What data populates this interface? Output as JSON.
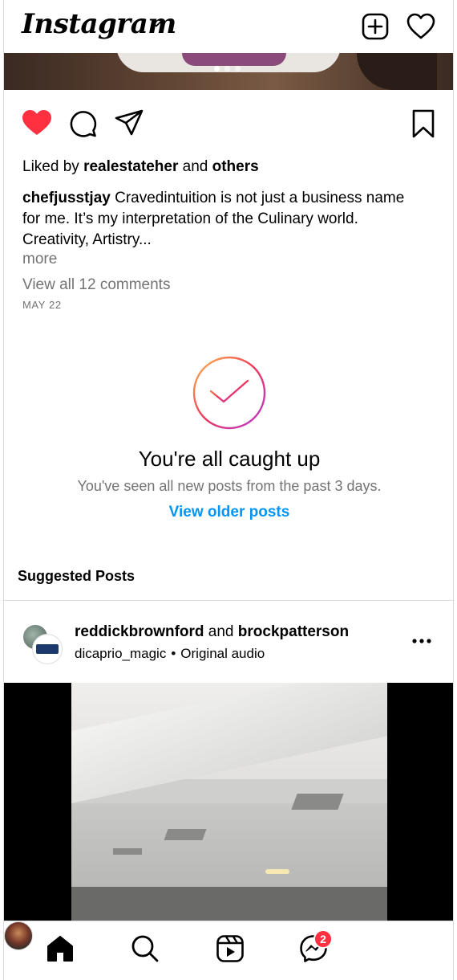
{
  "app": {
    "logo_text": "Instagram"
  },
  "prev_post": {
    "carousel_dots": 3,
    "active_dot": 1,
    "liked_by_prefix": "Liked by",
    "liked_by_user": "realestateher",
    "liked_by_joiner": "and",
    "liked_by_others": "others",
    "caption_user": "chefjusstjay",
    "caption_text": "Cravedintuition is not just a business name for me. It’s my interpretation of the Culinary world. Creativity, Artistry...",
    "more_label": "more",
    "view_comments_label": "View all 12 comments",
    "date": "MAY 22",
    "liked": true
  },
  "caught_up": {
    "title": "You're all caught up",
    "subtitle": "You've seen all new posts from the past 3 days.",
    "link_label": "View older posts"
  },
  "suggested": {
    "heading": "Suggested Posts",
    "post": {
      "user1": "reddickbrownford",
      "joiner": "and",
      "user2": "brockpatterson",
      "audio_user": "dicaprio_magic",
      "separator": "•",
      "audio_label": "Original audio"
    }
  },
  "bottom_nav": {
    "items": [
      {
        "icon": "home-icon",
        "active": true
      },
      {
        "icon": "search-icon"
      },
      {
        "icon": "reels-icon"
      },
      {
        "icon": "messenger-icon",
        "badge": "2"
      },
      {
        "icon": "profile-avatar"
      }
    ]
  },
  "colors": {
    "like_red": "#ff3040",
    "link_blue": "#0095f6",
    "secondary_text": "#737373",
    "border": "#dbdbdb",
    "badge_red": "#ff3040"
  }
}
